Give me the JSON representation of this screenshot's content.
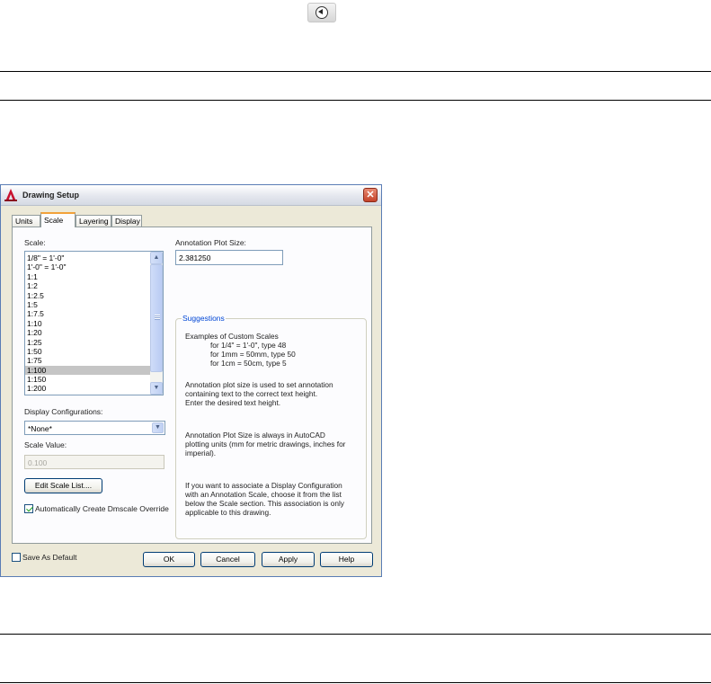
{
  "page": {
    "top_icon": "back-circle-arrow-icon"
  },
  "dialog": {
    "title": "Drawing Setup",
    "tabs": [
      "Units",
      "Scale",
      "Layering",
      "Display"
    ],
    "active_tab": "Scale",
    "scale_label": "Scale:",
    "scale_list": [
      "1/8\" = 1'-0\"",
      "1'-0\" = 1'-0\"",
      "1:1",
      "1:2",
      "1:2.5",
      "1:5",
      "1:7.5",
      "1:10",
      "1:20",
      "1:25",
      "1:50",
      "1:75",
      "1:100",
      "1:150",
      "1:200"
    ],
    "selected_scale": "1:100",
    "display_config_label": "Display Configurations:",
    "display_config_value": "*None*",
    "scale_value_label": "Scale Value:",
    "scale_value": "0.100",
    "edit_scale_button": "Edit Scale List....",
    "auto_create_label": "Automatically Create Dmscale Override",
    "auto_create_checked": true,
    "annotation_label": "Annotation Plot Size:",
    "annotation_value": "2.381250",
    "suggestions": {
      "title": "Suggestions",
      "examples_heading": "Examples of Custom Scales",
      "examples": [
        "for 1/4\" = 1'-0\", type 48",
        "for 1mm = 50mm, type 50",
        "for 1cm = 50cm, type 5"
      ],
      "para1": [
        "Annotation plot size is used to set annotation",
        "containing text to the correct text height.",
        "Enter the desired text height."
      ],
      "para2": [
        "Annotation Plot Size is always in AutoCAD",
        "plotting units (mm for metric drawings, inches for",
        "imperial)."
      ],
      "para3": [
        "If you want to associate a Display Configuration",
        "with an Annotation Scale, choose it from the list",
        "below the Scale section.  This association is only",
        "applicable to this drawing."
      ]
    },
    "save_default_label": "Save As Default",
    "save_default_checked": false,
    "buttons": {
      "ok": "OK",
      "cancel": "Cancel",
      "apply": "Apply",
      "help": "Help"
    },
    "close_glyph": "✕",
    "colors": {
      "accent": "#0046d5",
      "tab_highlight": "#f2a23a",
      "close": "#c4432a"
    }
  }
}
